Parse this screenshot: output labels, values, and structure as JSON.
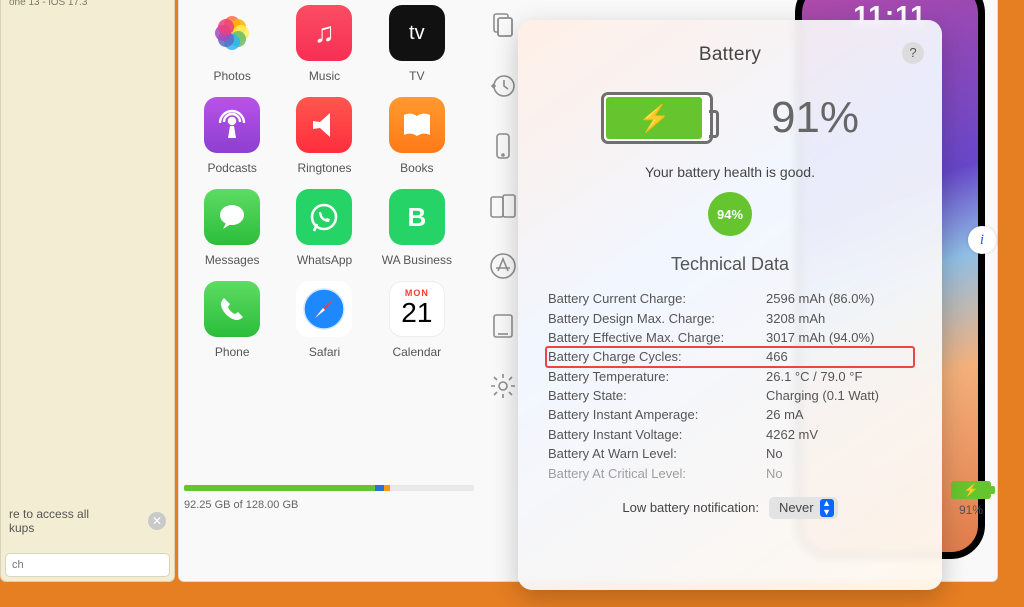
{
  "left": {
    "device_label": "one 13 - iOS 17.3",
    "note_text": "re to access all\nkups",
    "search_placeholder": "ch"
  },
  "apps": [
    {
      "name": "Photos",
      "icon": "photos-icon"
    },
    {
      "name": "Music",
      "icon": "music-icon"
    },
    {
      "name": "TV",
      "icon": "tv-icon"
    },
    {
      "name": "Podcasts",
      "icon": "podcasts-icon"
    },
    {
      "name": "Ringtones",
      "icon": "ringtones-icon"
    },
    {
      "name": "Books",
      "icon": "books-icon"
    },
    {
      "name": "Messages",
      "icon": "messages-icon"
    },
    {
      "name": "WhatsApp",
      "icon": "whatsapp-icon"
    },
    {
      "name": "WA Business",
      "icon": "wabusiness-icon"
    },
    {
      "name": "Phone",
      "icon": "phone-icon"
    },
    {
      "name": "Safari",
      "icon": "safari-icon"
    },
    {
      "name": "Calendar",
      "icon": "calendar-icon",
      "cal_dow": "MON",
      "cal_day": "21"
    }
  ],
  "storage": {
    "text": "92.25 GB of 128.00 GB",
    "segments": [
      {
        "color": "g",
        "pct": 66
      },
      {
        "color": "b",
        "pct": 3
      },
      {
        "color": "o",
        "pct": 2
      }
    ]
  },
  "toolbar": [
    "documents-icon",
    "history-icon",
    "phone-outline-icon",
    "devices-icon",
    "appstore-icon",
    "tablet-icon",
    "settings-icon"
  ],
  "phone": {
    "time": "11:11"
  },
  "mini_battery": {
    "pct": "91%"
  },
  "popover": {
    "title": "Battery",
    "pct": "91%",
    "health_text": "Your battery health is good.",
    "health_pct": "94%",
    "tech_title": "Technical Data",
    "rows": [
      {
        "k": "Battery Current Charge:",
        "v": "2596 mAh (86.0%)"
      },
      {
        "k": "Battery Design Max. Charge:",
        "v": "3208 mAh"
      },
      {
        "k": "Battery Effective Max. Charge:",
        "v": "3017 mAh (94.0%)"
      },
      {
        "k": "Battery Charge Cycles:",
        "v": "466",
        "highlight": true
      },
      {
        "k": "Battery Temperature:",
        "v": "26.1 °C / 79.0 °F"
      },
      {
        "k": "Battery State:",
        "v": "Charging (0.1 Watt)"
      },
      {
        "k": "Battery Instant Amperage:",
        "v": "26 mA"
      },
      {
        "k": "Battery Instant Voltage:",
        "v": "4262 mV"
      },
      {
        "k": "Battery At Warn Level:",
        "v": "No"
      },
      {
        "k": "Battery At Critical Level:",
        "v": "No",
        "fade": true
      }
    ],
    "notif_label": "Low battery notification:",
    "notif_value": "Never"
  }
}
